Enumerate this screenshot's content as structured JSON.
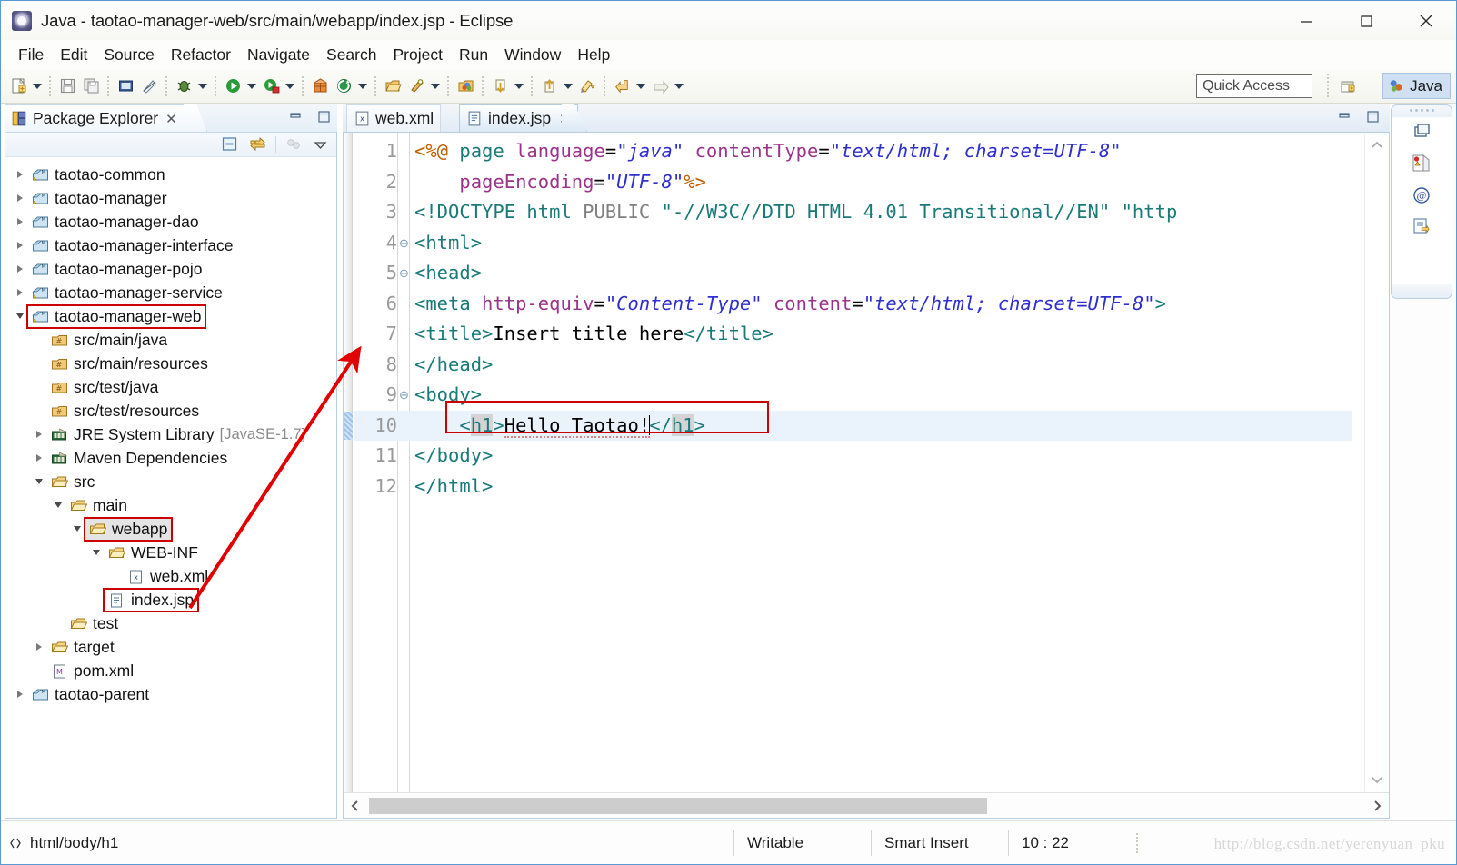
{
  "window": {
    "title": "Java - taotao-manager-web/src/main/webapp/index.jsp - Eclipse",
    "app_icon": "eclipse-icon",
    "minimize": "minimize-icon",
    "maximize": "maximize-icon",
    "close": "close-icon"
  },
  "menubar": {
    "items": [
      {
        "label": "File"
      },
      {
        "label": "Edit"
      },
      {
        "label": "Source"
      },
      {
        "label": "Refactor"
      },
      {
        "label": "Navigate"
      },
      {
        "label": "Search"
      },
      {
        "label": "Project"
      },
      {
        "label": "Run"
      },
      {
        "label": "Window"
      },
      {
        "label": "Help"
      }
    ]
  },
  "toolbar": {
    "quick_access_placeholder": "Quick Access",
    "perspective_label": "Java",
    "perspective_icon": "java-perspective-icon",
    "open_perspective_icon": "open-perspective-icon",
    "buttons": [
      {
        "icon": "new-wizard-icon",
        "dropdown": true
      },
      {
        "icon": "save-icon",
        "dropdown": false
      },
      {
        "icon": "save-all-icon",
        "dropdown": false
      },
      {
        "icon": "print-icon",
        "dropdown": false
      },
      {
        "icon": "toggle-mark-occurrences-icon",
        "dropdown": false
      },
      {
        "icon": "debug-icon",
        "dropdown": true
      },
      {
        "icon": "run-icon",
        "dropdown": true
      },
      {
        "icon": "run-external-tools-icon",
        "dropdown": true
      },
      {
        "icon": "new-java-package-icon",
        "dropdown": false
      },
      {
        "icon": "new-java-class-icon",
        "dropdown": true
      },
      {
        "icon": "open-type-icon",
        "dropdown": false
      },
      {
        "icon": "search-icon",
        "dropdown": true
      },
      {
        "icon": "open-task-icon",
        "dropdown": false
      },
      {
        "icon": "next-annotation-icon",
        "dropdown": true
      },
      {
        "icon": "previous-annotation-icon",
        "dropdown": true
      },
      {
        "icon": "last-edit-location-icon",
        "dropdown": false
      },
      {
        "icon": "back-icon",
        "dropdown": true
      },
      {
        "icon": "forward-icon",
        "dropdown": true
      }
    ]
  },
  "package_explorer": {
    "tab_label": "Package Explorer",
    "tab_icon": "package-explorer-icon",
    "tab_close": "close-icon",
    "minimize": "minimize-icon",
    "maximize": "maximize-icon",
    "view_tools": [
      {
        "icon": "collapse-all-icon"
      },
      {
        "icon": "link-with-editor-icon"
      },
      {
        "icon": "view-menu-filters-icon"
      },
      {
        "icon": "view-menu-icon"
      }
    ],
    "tree": [
      {
        "label": "taotao-common",
        "icon": "maven-project-icon",
        "indent": 0,
        "state": "collapsed",
        "highlight": false,
        "selected": false
      },
      {
        "label": "taotao-manager",
        "icon": "maven-project-icon",
        "indent": 0,
        "state": "collapsed",
        "highlight": false,
        "selected": false
      },
      {
        "label": "taotao-manager-dao",
        "icon": "java-project-icon",
        "indent": 0,
        "state": "collapsed",
        "highlight": false,
        "selected": false
      },
      {
        "label": "taotao-manager-interface",
        "icon": "java-project-icon",
        "indent": 0,
        "state": "collapsed",
        "highlight": false,
        "selected": false
      },
      {
        "label": "taotao-manager-pojo",
        "icon": "java-project-icon",
        "indent": 0,
        "state": "collapsed",
        "highlight": false,
        "selected": false
      },
      {
        "label": "taotao-manager-service",
        "icon": "maven-project-icon",
        "indent": 0,
        "state": "collapsed",
        "highlight": false,
        "selected": false
      },
      {
        "label": "taotao-manager-web",
        "icon": "maven-project-icon",
        "indent": 0,
        "state": "expanded",
        "highlight": true,
        "selected": false
      },
      {
        "label": "src/main/java",
        "icon": "source-folder-icon",
        "indent": 1,
        "state": "none",
        "highlight": false,
        "selected": false
      },
      {
        "label": "src/main/resources",
        "icon": "source-folder-icon",
        "indent": 1,
        "state": "none",
        "highlight": false,
        "selected": false
      },
      {
        "label": "src/test/java",
        "icon": "source-folder-icon",
        "indent": 1,
        "state": "none",
        "highlight": false,
        "selected": false
      },
      {
        "label": "src/test/resources",
        "icon": "source-folder-icon",
        "indent": 1,
        "state": "none",
        "highlight": false,
        "selected": false
      },
      {
        "label": "JRE System Library",
        "icon": "library-icon",
        "indent": 1,
        "state": "collapsed",
        "highlight": false,
        "selected": false,
        "suffix": "[JavaSE-1.7]"
      },
      {
        "label": "Maven Dependencies",
        "icon": "library-icon",
        "indent": 1,
        "state": "collapsed",
        "highlight": false,
        "selected": false
      },
      {
        "label": "src",
        "icon": "folder-icon",
        "indent": 1,
        "state": "expanded",
        "highlight": false,
        "selected": false
      },
      {
        "label": "main",
        "icon": "folder-icon",
        "indent": 2,
        "state": "expanded",
        "highlight": false,
        "selected": false
      },
      {
        "label": "webapp",
        "icon": "folder-icon",
        "indent": 3,
        "state": "expanded",
        "highlight": true,
        "selected": true
      },
      {
        "label": "WEB-INF",
        "icon": "folder-icon",
        "indent": 4,
        "state": "expanded",
        "highlight": false,
        "selected": false
      },
      {
        "label": "web.xml",
        "icon": "xml-file-icon",
        "indent": 5,
        "state": "none",
        "highlight": false,
        "selected": false
      },
      {
        "label": "index.jsp",
        "icon": "jsp-file-icon",
        "indent": 4,
        "state": "none",
        "highlight": true,
        "selected": false
      },
      {
        "label": "test",
        "icon": "folder-icon",
        "indent": 2,
        "state": "none",
        "highlight": false,
        "selected": false
      },
      {
        "label": "target",
        "icon": "folder-icon",
        "indent": 1,
        "state": "collapsed",
        "highlight": false,
        "selected": false
      },
      {
        "label": "pom.xml",
        "icon": "pom-file-icon",
        "indent": 1,
        "state": "none",
        "highlight": false,
        "selected": false
      },
      {
        "label": "taotao-parent",
        "icon": "java-project-icon",
        "indent": 0,
        "state": "collapsed",
        "highlight": false,
        "selected": false
      }
    ]
  },
  "editor": {
    "tabs": [
      {
        "label": "web.xml",
        "icon": "xml-file-icon",
        "active": false,
        "closable": false
      },
      {
        "label": "index.jsp",
        "icon": "jsp-file-icon",
        "active": true,
        "closable": true
      }
    ],
    "minimize": "minimize-icon",
    "maximize": "maximize-icon",
    "highlighted_line": 10,
    "scroll_up_icon": "chevron-up-icon",
    "scroll_down_icon": "chevron-down-icon",
    "hscroll_left_icon": "chevron-left-icon",
    "hscroll_right_icon": "chevron-right-icon",
    "lines": [
      {
        "n": 1,
        "fold": "",
        "tokens": [
          {
            "t": "<%@ ",
            "c": "dir"
          },
          {
            "t": "page ",
            "c": "tag"
          },
          {
            "t": "language",
            "c": "attr"
          },
          {
            "t": "=",
            "c": "plain"
          },
          {
            "t": "\"java\"",
            "c": "val"
          },
          {
            "t": " contentType",
            "c": "attr"
          },
          {
            "t": "=",
            "c": "plain"
          },
          {
            "t": "\"text/html; charset=UTF-8\"",
            "c": "val"
          }
        ]
      },
      {
        "n": 2,
        "fold": "",
        "tokens": [
          {
            "t": "    pageEncoding",
            "c": "attr"
          },
          {
            "t": "=",
            "c": "plain"
          },
          {
            "t": "\"UTF-8\"",
            "c": "val"
          },
          {
            "t": "%>",
            "c": "dir"
          }
        ]
      },
      {
        "n": 3,
        "fold": "",
        "tokens": [
          {
            "t": "<!DOCTYPE",
            "c": "tag"
          },
          {
            "t": " html",
            "c": "tag"
          },
          {
            "t": " PUBLIC",
            "c": "gray"
          },
          {
            "t": " \"-//W3C//DTD HTML 4.01 Transitional//EN\"",
            "c": "tag"
          },
          {
            "t": " \"http",
            "c": "tag"
          }
        ]
      },
      {
        "n": 4,
        "fold": "⊖",
        "tokens": [
          {
            "t": "<html>",
            "c": "tag"
          }
        ]
      },
      {
        "n": 5,
        "fold": "⊖",
        "tokens": [
          {
            "t": "<head>",
            "c": "tag"
          }
        ]
      },
      {
        "n": 6,
        "fold": "",
        "tokens": [
          {
            "t": "<meta",
            "c": "tag"
          },
          {
            "t": " http-equiv",
            "c": "attr"
          },
          {
            "t": "=",
            "c": "plain"
          },
          {
            "t": "\"Content-Type\"",
            "c": "val"
          },
          {
            "t": " content",
            "c": "attr"
          },
          {
            "t": "=",
            "c": "plain"
          },
          {
            "t": "\"text/html; charset=UTF-8\"",
            "c": "val"
          },
          {
            "t": ">",
            "c": "tag"
          }
        ]
      },
      {
        "n": 7,
        "fold": "",
        "tokens": [
          {
            "t": "<title>",
            "c": "tag"
          },
          {
            "t": "Insert title here",
            "c": "plain"
          },
          {
            "t": "</title>",
            "c": "tag"
          }
        ]
      },
      {
        "n": 8,
        "fold": "",
        "tokens": [
          {
            "t": "</head>",
            "c": "tag"
          }
        ]
      },
      {
        "n": 9,
        "fold": "⊖",
        "tokens": [
          {
            "t": "<body>",
            "c": "tag"
          }
        ]
      },
      {
        "n": 10,
        "fold": "",
        "tokens": [
          {
            "t": "    ",
            "c": "plain"
          },
          {
            "t": "<",
            "c": "tag"
          },
          {
            "t": "h1",
            "c": "tag",
            "sel": true
          },
          {
            "t": ">",
            "c": "tag"
          },
          {
            "t": "Hello Taotao!",
            "c": "plain",
            "squiggle": true
          },
          {
            "t": "|caret|",
            "c": "caret"
          },
          {
            "t": "</",
            "c": "tag"
          },
          {
            "t": "h1",
            "c": "tag",
            "sel": true
          },
          {
            "t": ">",
            "c": "tag"
          }
        ]
      },
      {
        "n": 11,
        "fold": "",
        "tokens": [
          {
            "t": "</body>",
            "c": "tag"
          }
        ]
      },
      {
        "n": 12,
        "fold": "",
        "tokens": [
          {
            "t": "</html>",
            "c": "tag"
          }
        ]
      }
    ]
  },
  "fastview": {
    "icons": [
      {
        "icon": "restore-view-icon"
      },
      {
        "icon": "problems-view-icon"
      },
      {
        "icon": "javadoc-view-icon"
      },
      {
        "icon": "declaration-view-icon"
      }
    ]
  },
  "statusbar": {
    "breadcrumb_icon": "code-path-icon",
    "breadcrumb": "html/body/h1",
    "writable": "Writable",
    "insert_mode": "Smart Insert",
    "cursor_position": "10 : 22",
    "watermark": "http://blog.csdn.net/yerenyuan_pku"
  },
  "colors": {
    "tag": "#1a7a7a",
    "attribute": "#9a348a",
    "value": "#2f2fd0",
    "directive": "#c06000",
    "annotation_red": "#cc0000",
    "line_highlight": "#eaf2fb"
  }
}
